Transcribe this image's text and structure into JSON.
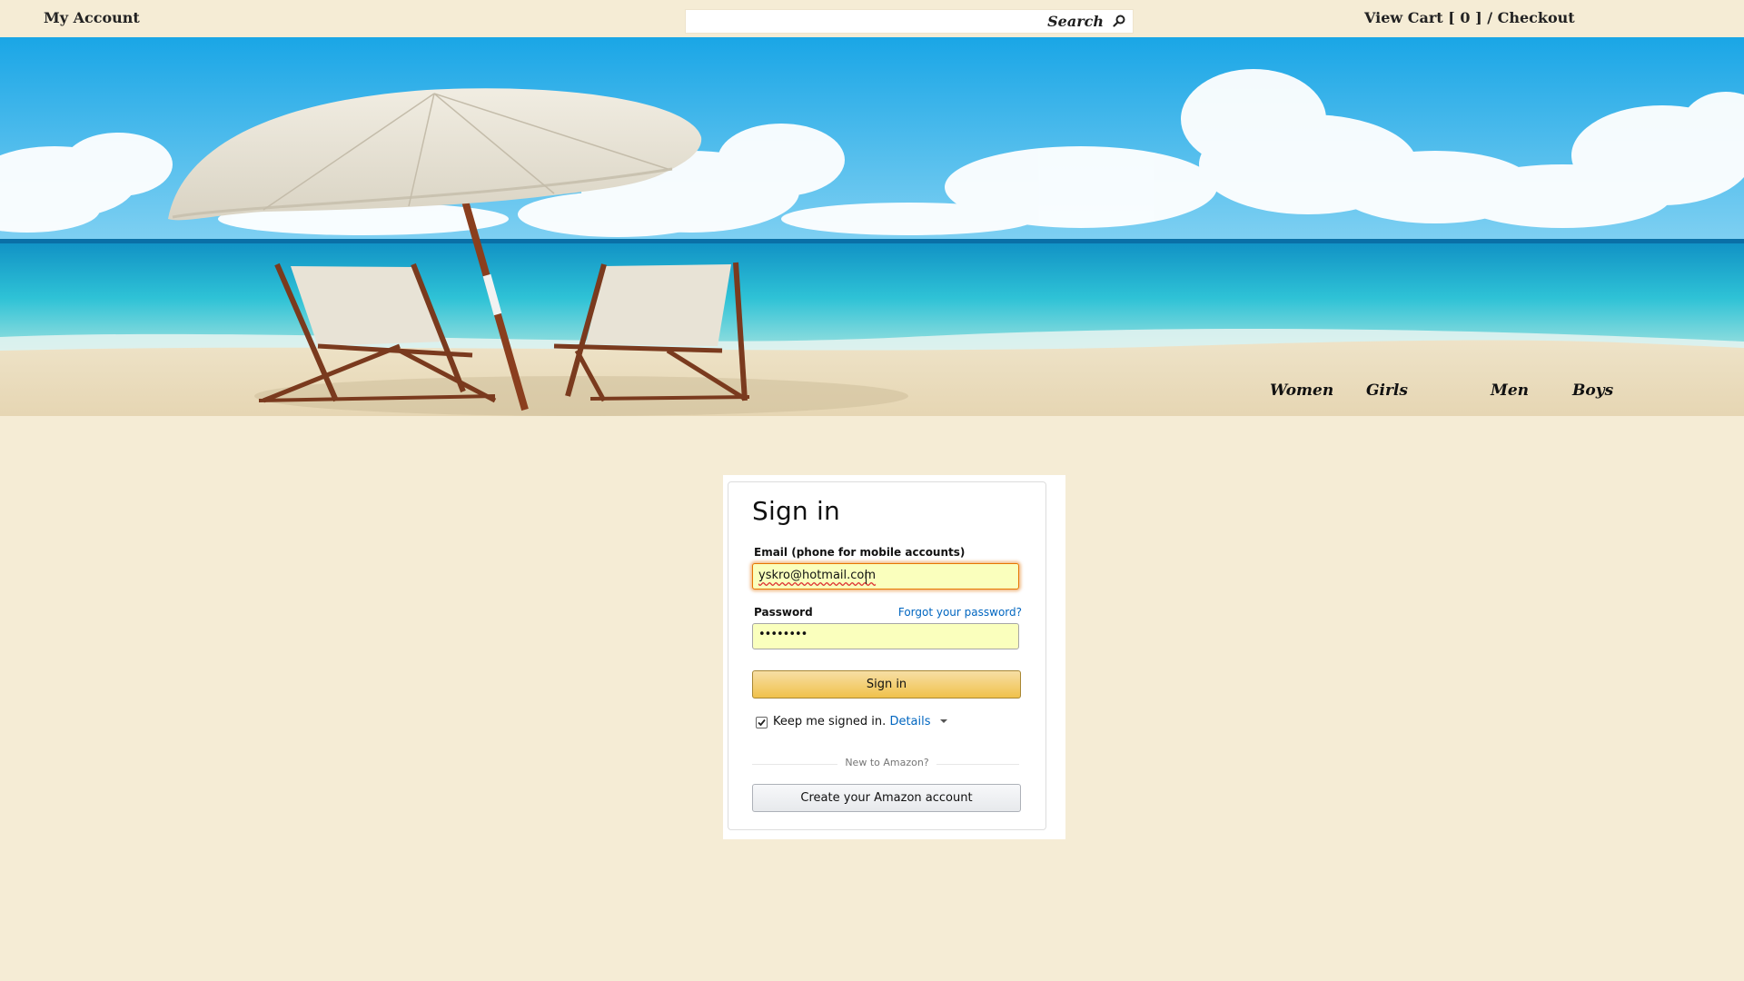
{
  "header": {
    "my_account": "My Account",
    "search_label": "Search",
    "cart": "View Cart [ 0 ] / Checkout"
  },
  "nav": {
    "women": "Women",
    "girls": "Girls",
    "men": "Men",
    "boys": "Boys"
  },
  "signin": {
    "title": "Sign in",
    "email_label": "Email (phone for mobile accounts)",
    "email_value": "yskro@hotmail.com",
    "password_label": "Password",
    "forgot_link": "Forgot your password?",
    "password_value": "••••••••",
    "signin_button": "Sign in",
    "keep_signed_in": "Keep me signed in.",
    "keep_signed_in_checked": true,
    "details_link": "Details",
    "new_to_amazon": "New to Amazon?",
    "create_account_button": "Create your Amazon account",
    "accent_color": "#f0c14b",
    "link_color": "#0066c0"
  }
}
